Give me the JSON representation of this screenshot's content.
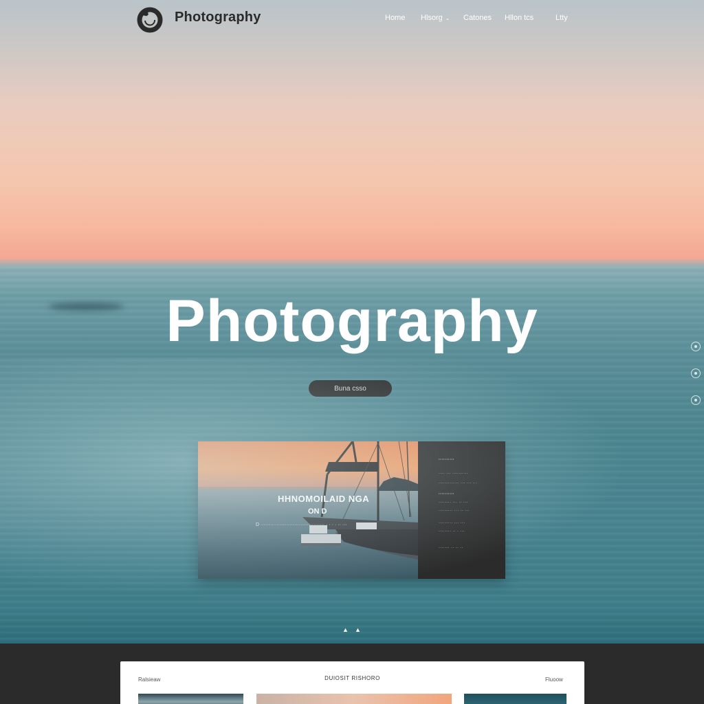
{
  "brand": {
    "name": "Photography"
  },
  "nav": {
    "items": [
      {
        "label": "Home"
      },
      {
        "label": "Hlsorg",
        "has_dropdown": true
      },
      {
        "label": "Catones"
      },
      {
        "label": "Hllon tcs"
      },
      {
        "label": "Ltty"
      }
    ]
  },
  "hero": {
    "title": "Photography",
    "cta_label": "Buna csso"
  },
  "feature_card": {
    "title": "HHNOMOILAID NGA",
    "subtitle": "ON D",
    "caption": "D  ········································  ·  ·  ·   ·  ··  ···",
    "panel_rows": [
      "··········",
      "···· ··· ··········",
      "·············  ···  ···  ···",
      "··········",
      "········  ···  ··  ···",
      "·········  ···  ··  ···",
      "·········  ···  ···",
      "········  ··  ·  ···",
      "·······  ··  ··  ··"
    ]
  },
  "pager": {
    "dots": [
      "▲",
      "▲"
    ]
  },
  "bottom_panel": {
    "left_label": "Ralsieaw",
    "center_title": "DUIOSIT RISHORO",
    "right_label": "Fluoow"
  },
  "colors": {
    "accent_dark": "#2d2d2d",
    "hero_text": "#ffffff",
    "sky_top": "#e8ccc0",
    "horizon": "#f3a894",
    "sea": "#4d8791"
  },
  "icons": [
    "logo-ring-icon",
    "chevron-down-icon",
    "side-nav-dot-icon"
  ]
}
